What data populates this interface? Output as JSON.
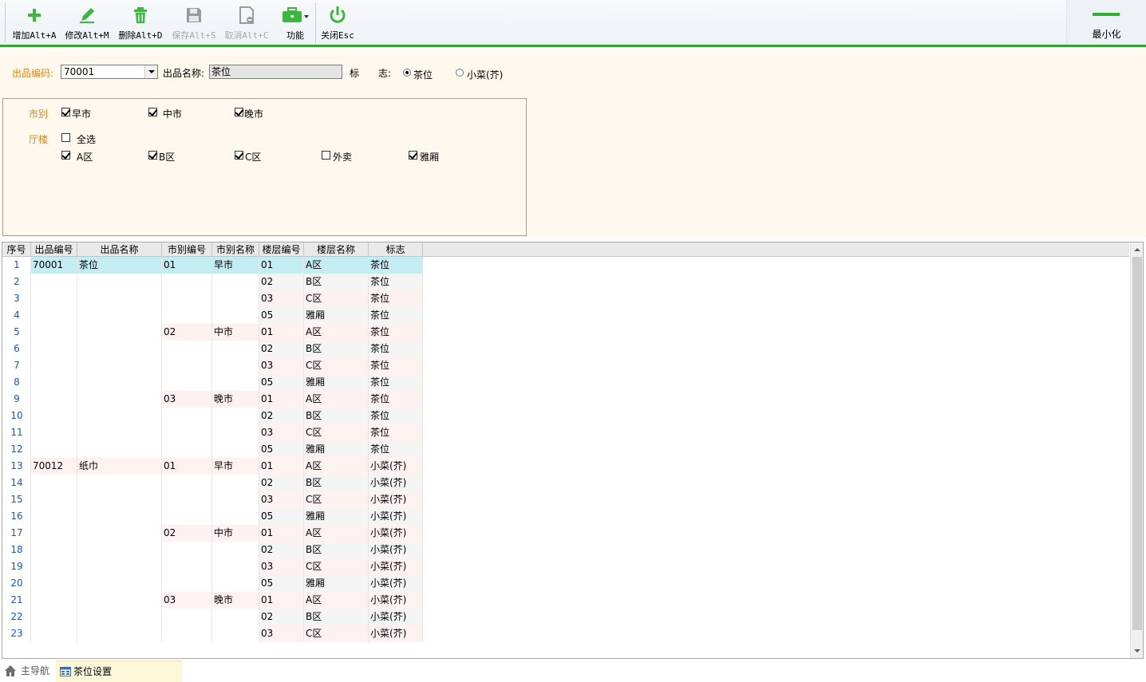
{
  "toolbar": {
    "buttons": [
      {
        "id": "add",
        "label": "增加Alt+A",
        "icon": "plus-icon",
        "enabled": true
      },
      {
        "id": "edit",
        "label": "修改Alt+M",
        "icon": "pencil-icon",
        "enabled": true
      },
      {
        "id": "delete",
        "label": "删除Alt+D",
        "icon": "trash-icon",
        "enabled": true
      },
      {
        "id": "save",
        "label": "保存Alt+S",
        "icon": "floppy-icon",
        "enabled": false
      },
      {
        "id": "cancel",
        "label": "取消Alt+C",
        "icon": "cancel-doc-icon",
        "enabled": false
      },
      {
        "id": "function",
        "label": "功能",
        "icon": "briefcase-icon",
        "enabled": true
      },
      {
        "id": "close",
        "label": "关闭Esc",
        "icon": "power-icon",
        "enabled": true
      }
    ],
    "minimize_label": "最小化"
  },
  "form": {
    "code_label": "出品编码:",
    "code_value": "70001",
    "name_label": "出品名称:",
    "name_value": "茶位",
    "flag_label_1": "标",
    "flag_label_2": "志:",
    "flag_options": [
      {
        "label": "茶位",
        "selected": true
      },
      {
        "label": "小菜(芥)",
        "selected": false
      }
    ]
  },
  "filters": {
    "market_label": "市别",
    "markets": [
      {
        "label": "早市",
        "checked": true
      },
      {
        "label": "中市",
        "checked": true
      },
      {
        "label": "晚市",
        "checked": true
      }
    ],
    "floor_label": "厅楼",
    "select_all": {
      "label": "全选",
      "checked": false
    },
    "floors": [
      {
        "label": "A区",
        "checked": true
      },
      {
        "label": "B区",
        "checked": true
      },
      {
        "label": "C区",
        "checked": true
      },
      {
        "label": "外卖",
        "checked": false
      },
      {
        "label": "雅厢",
        "checked": true
      }
    ]
  },
  "grid": {
    "columns": [
      "序号",
      "出品编号",
      "出品名称",
      "市别编号",
      "市别名称",
      "楼层编号",
      "楼层名称",
      "标志"
    ],
    "rows": [
      [
        "1",
        "70001",
        "茶位",
        "01",
        "早市",
        "01",
        "A区",
        "茶位"
      ],
      [
        "2",
        "",
        "",
        "",
        "",
        "02",
        "B区",
        "茶位"
      ],
      [
        "3",
        "",
        "",
        "",
        "",
        "03",
        "C区",
        "茶位"
      ],
      [
        "4",
        "",
        "",
        "",
        "",
        "05",
        "雅厢",
        "茶位"
      ],
      [
        "5",
        "",
        "",
        "02",
        "中市",
        "01",
        "A区",
        "茶位"
      ],
      [
        "6",
        "",
        "",
        "",
        "",
        "02",
        "B区",
        "茶位"
      ],
      [
        "7",
        "",
        "",
        "",
        "",
        "03",
        "C区",
        "茶位"
      ],
      [
        "8",
        "",
        "",
        "",
        "",
        "05",
        "雅厢",
        "茶位"
      ],
      [
        "9",
        "",
        "",
        "03",
        "晚市",
        "01",
        "A区",
        "茶位"
      ],
      [
        "10",
        "",
        "",
        "",
        "",
        "02",
        "B区",
        "茶位"
      ],
      [
        "11",
        "",
        "",
        "",
        "",
        "03",
        "C区",
        "茶位"
      ],
      [
        "12",
        "",
        "",
        "",
        "",
        "05",
        "雅厢",
        "茶位"
      ],
      [
        "13",
        "70012",
        "纸巾",
        "01",
        "早市",
        "01",
        "A区",
        "小菜(芥)"
      ],
      [
        "14",
        "",
        "",
        "",
        "",
        "02",
        "B区",
        "小菜(芥)"
      ],
      [
        "15",
        "",
        "",
        "",
        "",
        "03",
        "C区",
        "小菜(芥)"
      ],
      [
        "16",
        "",
        "",
        "",
        "",
        "05",
        "雅厢",
        "小菜(芥)"
      ],
      [
        "17",
        "",
        "",
        "02",
        "中市",
        "01",
        "A区",
        "小菜(芥)"
      ],
      [
        "18",
        "",
        "",
        "",
        "",
        "02",
        "B区",
        "小菜(芥)"
      ],
      [
        "19",
        "",
        "",
        "",
        "",
        "03",
        "C区",
        "小菜(芥)"
      ],
      [
        "20",
        "",
        "",
        "",
        "",
        "05",
        "雅厢",
        "小菜(芥)"
      ],
      [
        "21",
        "",
        "",
        "03",
        "晚市",
        "01",
        "A区",
        "小菜(芥)"
      ],
      [
        "22",
        "",
        "",
        "",
        "",
        "02",
        "B区",
        "小菜(芥)"
      ],
      [
        "23",
        "",
        "",
        "",
        "",
        "03",
        "C区",
        "小菜(芥)"
      ]
    ],
    "selected_row": 0
  },
  "tabs": {
    "home_label": "主导航",
    "active_label": "茶位设置"
  },
  "colors": {
    "accent_green": "#2fa531",
    "label_orange": "#e0860b",
    "selected_row": "#c4ecf3",
    "panel_bg": "#fff8ee"
  }
}
